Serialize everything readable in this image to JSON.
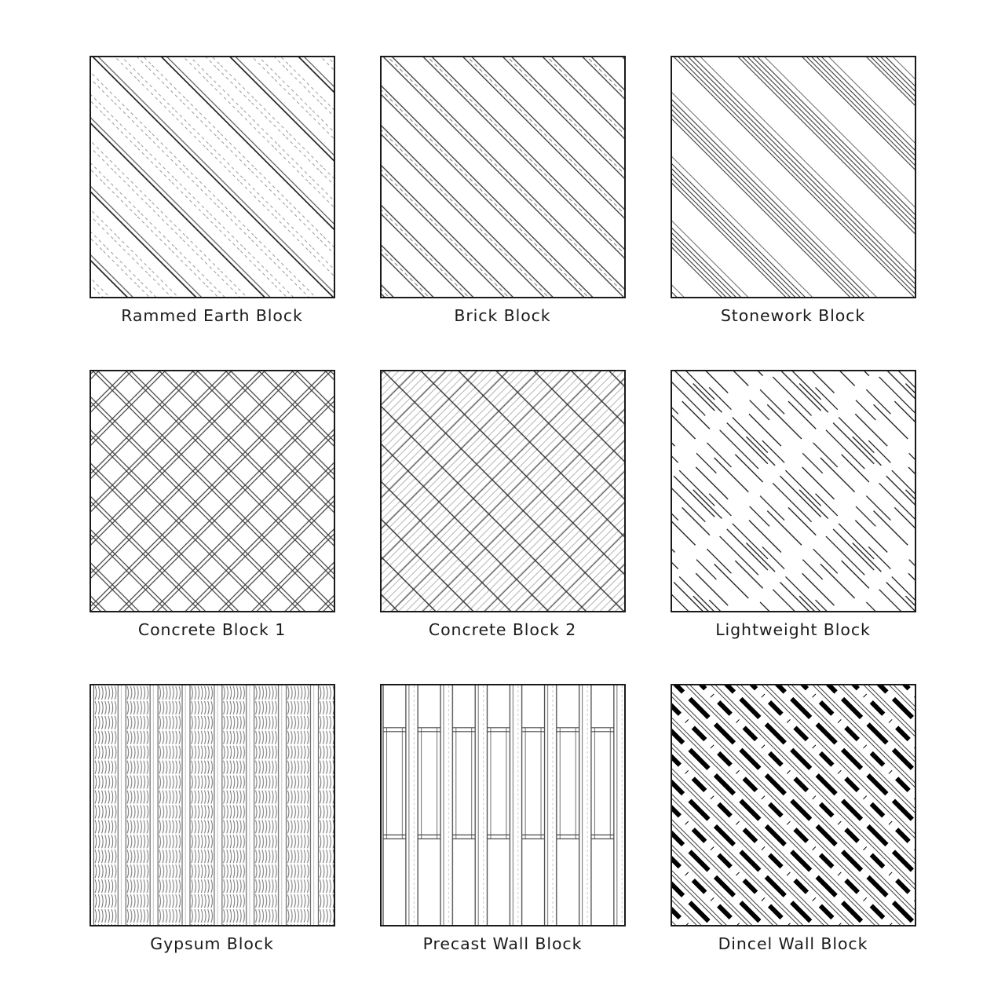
{
  "sheet": {
    "background_color": "#ffffff",
    "border_color": "#1a1a1a",
    "label_color": "#1a1a1a",
    "columns": 3,
    "rows": 3
  },
  "tiles": [
    {
      "id": "rammed-earth-block",
      "label": "Rammed Earth Block",
      "pattern": "diagonal-solid-pairs-with-dashed",
      "row": 1,
      "column": 1
    },
    {
      "id": "brick-block",
      "label": "Brick Block",
      "pattern": "diagonal-double-line-bands-with-center-dash",
      "row": 1,
      "column": 2
    },
    {
      "id": "stonework-block",
      "label": "Stonework Block",
      "pattern": "diagonal-line-clusters",
      "row": 1,
      "column": 3
    },
    {
      "id": "concrete-block-1",
      "label": "Concrete Block 1",
      "pattern": "double-line-crosshatch",
      "row": 2,
      "column": 1
    },
    {
      "id": "concrete-block-2",
      "label": "Concrete Block 2",
      "pattern": "fine-hatch-plus-coarse-crosshatch",
      "row": 2,
      "column": 2
    },
    {
      "id": "lightweight-block",
      "label": "Lightweight Block",
      "pattern": "broken-diagonal-strokes",
      "row": 2,
      "column": 3
    },
    {
      "id": "gypsum-block",
      "label": "Gypsum Block",
      "pattern": "vertical-bands-of-squiggles",
      "row": 3,
      "column": 1
    },
    {
      "id": "precast-wall-block",
      "label": "Precast Wall Block",
      "pattern": "vertical-panels-with-joints",
      "row": 3,
      "column": 2
    },
    {
      "id": "dincel-wall-block",
      "label": "Dincel Wall Block",
      "pattern": "bold-dashed-diagonals",
      "row": 3,
      "column": 3
    }
  ]
}
